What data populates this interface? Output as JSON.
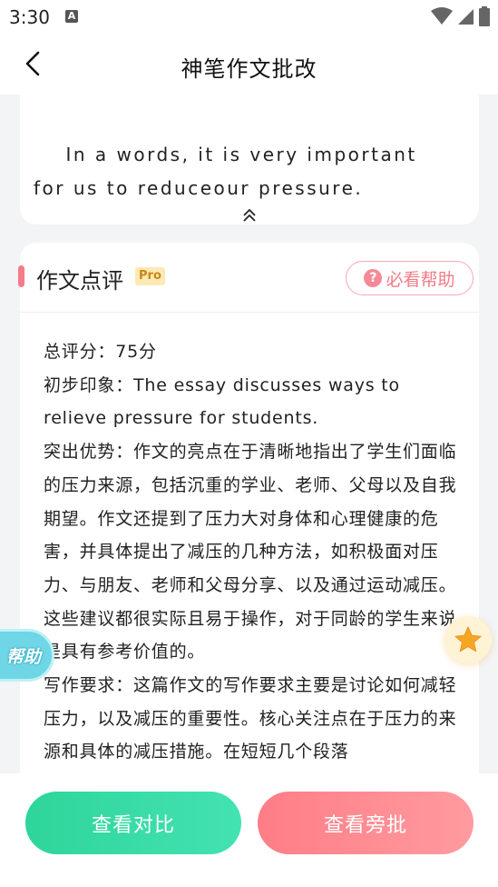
{
  "status_bar": {
    "time": "3:30",
    "notification_icon": "A"
  },
  "header": {
    "title": "神笔作文批改"
  },
  "essay": {
    "text": "    In a words, it is very important\nfor us to reduceour pressure."
  },
  "review": {
    "title": "作文点评",
    "badge": "Pro",
    "help_label": "必看帮助",
    "help_icon": "?",
    "score_line": "总评分：75分",
    "impression_line": "初步印象：The essay discusses ways to relieve pressure for students.",
    "strengths_line": "突出优势：作文的亮点在于清晰地指出了学生们面临的压力来源，包括沉重的学业、老师、父母以及自我期望。作文还提到了压力大对身体和心理健康的危害，并具体提出了减压的几种方法，如积极面对压力、与朋友、老师和父母分享、以及通过运动减压。这些建议都很实际且易于操作，对于同龄的学生来说是具有参考价值的。",
    "requirements_line": "写作要求：这篇作文的写作要求主要是讨论如何减轻压力，以及减压的重要性。核心关注点在于压力的来源和具体的减压措施。在短短几个段落"
  },
  "floating": {
    "help_label": "帮助"
  },
  "buttons": {
    "compare": "查看对比",
    "annotate": "查看旁批"
  },
  "colors": {
    "accent_pink": "#f57c88",
    "compare_green": "#2ed59a",
    "annotate_red": "#ff7d86",
    "floating_cyan": "#6fd6e6",
    "star_orange": "#f5a623"
  }
}
